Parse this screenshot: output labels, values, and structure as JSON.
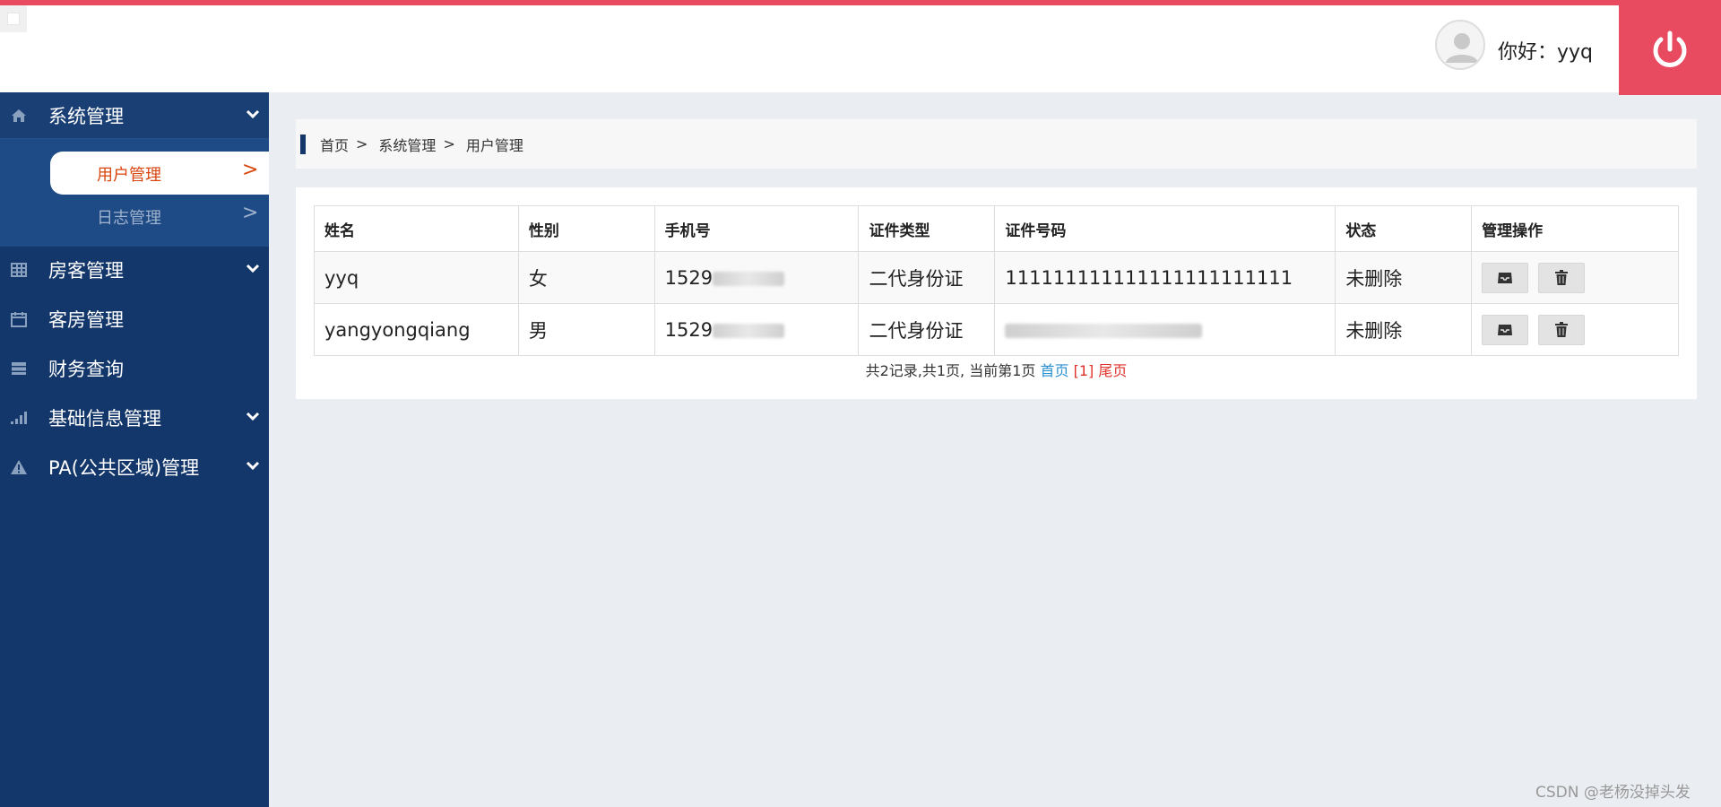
{
  "header": {
    "greeting": "你好：yyq",
    "accent_color": "#e84a5f",
    "power_icon": "power-icon",
    "avatar_icon": "user-avatar-icon"
  },
  "sidebar": {
    "bg_color": "#14376b",
    "items": [
      {
        "label": "系统管理",
        "icon": "home-icon",
        "expanded": true,
        "children": [
          {
            "label": "用户管理",
            "arrow": ">",
            "active": true
          },
          {
            "label": "日志管理",
            "arrow": ">",
            "active": false
          }
        ]
      },
      {
        "label": "房客管理",
        "icon": "grid-icon"
      },
      {
        "label": "客房管理",
        "icon": "calendar-icon"
      },
      {
        "label": "财务查询",
        "icon": "server-icon"
      },
      {
        "label": "基础信息管理",
        "icon": "signal-bars-icon"
      },
      {
        "label": "PA(公共区域)管理",
        "icon": "warning-icon"
      }
    ]
  },
  "breadcrumb": {
    "items": [
      "首页",
      "系统管理",
      "用户管理"
    ],
    "separator": ">"
  },
  "table": {
    "columns": [
      "姓名",
      "性别",
      "手机号",
      "证件类型",
      "证件号码",
      "状态",
      "管理操作"
    ],
    "rows": [
      {
        "name": "yyq",
        "gender": "女",
        "phone": "1529",
        "id_type": "二代身份证",
        "id_number": "111111111111111111111111",
        "status": "未删除"
      },
      {
        "name": "yangyongqiang",
        "gender": "男",
        "phone": "1529",
        "id_type": "二代身份证",
        "id_number": "",
        "status": "未删除"
      }
    ],
    "row_actions": [
      "inbox-icon",
      "trash-icon"
    ]
  },
  "pager": {
    "summary": "共2记录,共1页, 当前第1页",
    "first": "首页",
    "current": "[1]",
    "last": "尾页"
  },
  "watermark": "CSDN @老杨没掉头发"
}
